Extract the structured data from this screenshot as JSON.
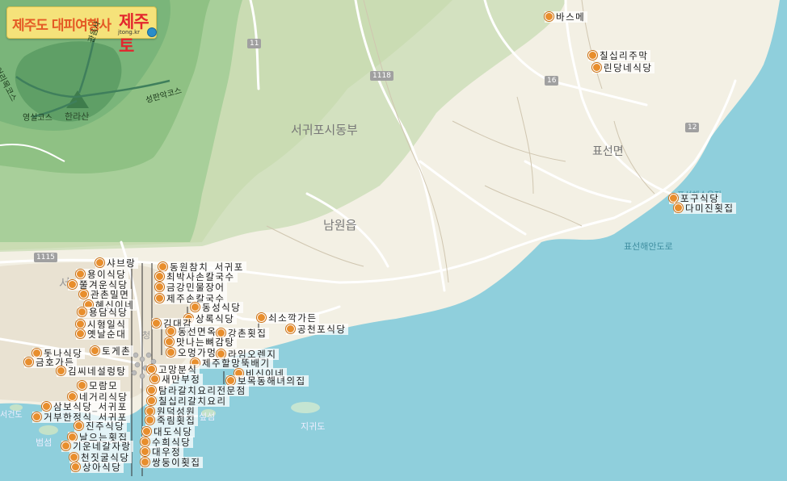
{
  "logo": {
    "text_main": "제주도 대피여행사",
    "text_brand": "제주토",
    "text_url": "jtong.kr"
  },
  "colors": {
    "land": "#f3f0e4",
    "sea": "#8fcfdc",
    "mountain_dark": "#6fad73",
    "mountain_light": "#a8cf9a",
    "poi_pin": "#e88e2d",
    "road": "#ffffff"
  },
  "place_labels": {
    "seogwipo_east": "서귀포시동부",
    "namwon": "남원읍",
    "pyoseon": "표선면",
    "hallasan": "한라산",
    "eorimok": "어리목코스",
    "gwaneum": "관음사",
    "seongpanak": "성판악코스",
    "yeongsil": "영실코스",
    "pyoseon_road": "표선해안도로",
    "pyoseon_beach": "표선해수욕장",
    "jigwido": "지귀도",
    "seogeondo": "서건도",
    "beomseom": "범섬",
    "seop": "섶섬",
    "seo_fragment": "서",
    "cheong": "청"
  },
  "route_shields": [
    "11",
    "1118",
    "16",
    "12",
    "1115"
  ],
  "pois": [
    "바스메",
    "칠십리주막",
    "린당네식당",
    "포구식당",
    "다미진횟집",
    "샤브랑",
    "용이식당",
    "쭐겨운식당",
    "관촌밀면",
    "혜신이네",
    "용담식당",
    "시형일식",
    "옛날순대",
    "토게촌",
    "돗나식당",
    "금호가든",
    "김씨네설렁탕",
    "모람모",
    "네거리식당",
    "삼보식당_서귀포",
    "거부한정식_서귀포",
    "진주식당",
    "날으는횟집",
    "기운네갈자랑",
    "천짓굴식당",
    "상아식당",
    "동원참치_서귀포",
    "최박사손칼국수",
    "금강민물장어",
    "제주손칼국수",
    "동성식당",
    "상록식당",
    "쇠소깍가든",
    "공천포식당",
    "김대감",
    "동선면옥",
    "강촌횟집",
    "맛나는뼈감탕",
    "오멍가멍",
    "라임오렌지",
    "제주할망뚝배기",
    "고망분식",
    "새만부정",
    "비신이네",
    "보목동해녀의집",
    "탐라갈치요리전문점",
    "칠십리갈치요리",
    "원덕성원",
    "죽림횟집",
    "대도식당",
    "수희식당",
    "대우정",
    "쌍둥이횟집"
  ]
}
